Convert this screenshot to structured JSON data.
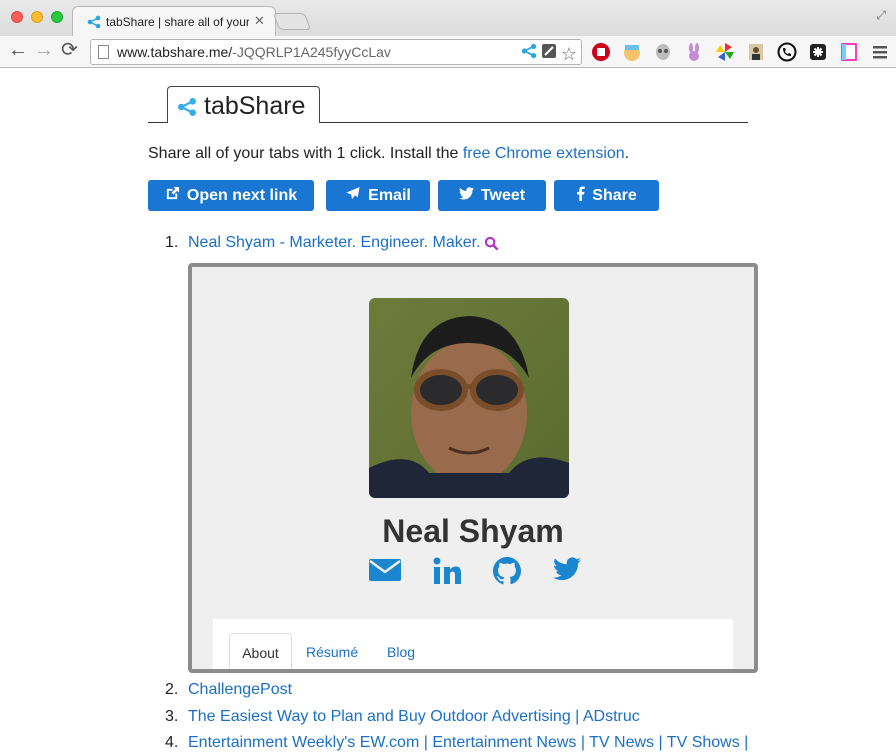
{
  "browser": {
    "tab_title": "tabShare | share all of your",
    "url_host": "www.tabshare.me/",
    "url_path": "-JQQRLP1A245fyyCcLav"
  },
  "brand": {
    "name": "tabShare"
  },
  "intro": {
    "text": "Share all of your tabs with 1 click. Install the ",
    "link": "free Chrome extension",
    "suffix": "."
  },
  "actions": {
    "open_next": "Open next link",
    "email": "Email",
    "tweet": "Tweet",
    "share": "Share"
  },
  "links": [
    {
      "num": "1.",
      "title": "Neal Shyam - Marketer. Engineer. Maker."
    },
    {
      "num": "2.",
      "title": "ChallengePost"
    },
    {
      "num": "3.",
      "title": "The Easiest Way to Plan and Buy Outdoor Advertising | ADstruc"
    },
    {
      "num": "4.",
      "title": "Entertainment Weekly's EW.com | Entertainment News | TV News | TV Shows |"
    }
  ],
  "preview": {
    "name": "Neal Shyam",
    "tabs": [
      "About",
      "Résumé",
      "Blog"
    ]
  },
  "colors": {
    "accent": "#1976d2",
    "link": "#1a6fc9",
    "search_icon": "#b22fc1"
  }
}
